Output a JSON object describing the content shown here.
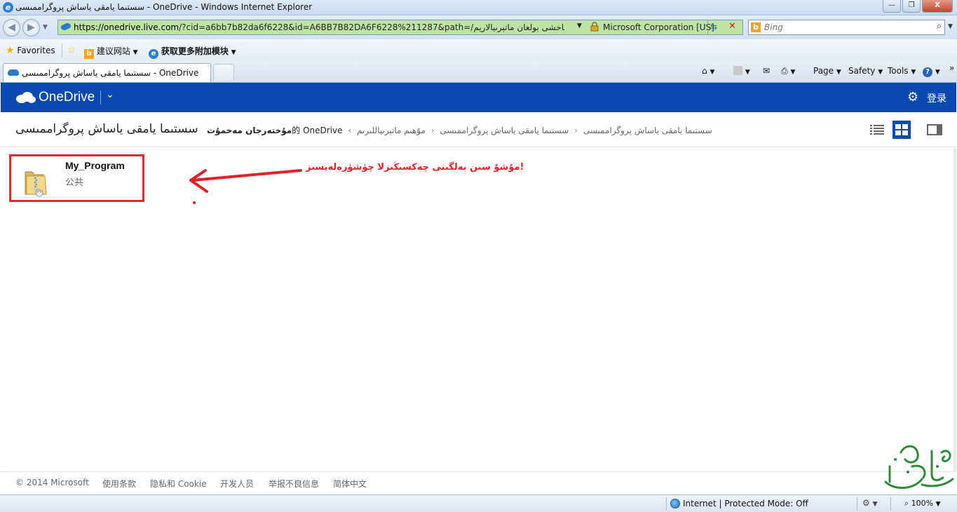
{
  "window": {
    "title": "سستىما يامقى ياساش پروگراممىسى - OneDrive - Windows Internet Explorer",
    "controls": {
      "minimize": "—",
      "maximize": "❐",
      "close": "X"
    }
  },
  "nav": {
    "back_icon": "back-arrow-icon",
    "forward_icon": "forward-arrow-icon",
    "address_host": "https://onedrive.live.com",
    "address_rest": "/?cid=a6bb7b82da6f6228&id=A6BB7B82DA6F6228%211287&path=/سستىما يامقى ياساش پروگراممىسى/ئىنتايىن ساپلىقى ياخشى بولغان ماتېرىيالاريم",
    "certificate": "Microsoft Corporation [US]",
    "search_placeholder": "Bing"
  },
  "favorites_bar": {
    "favorites_label": "Favorites",
    "suggested_sites": "建议网站",
    "get_more_addons": "获取更多附加模块"
  },
  "tabs": [
    {
      "label": "سستىما يامقى ياساش پروگراممىسى - OneDrive"
    }
  ],
  "command_bar": {
    "page": "Page",
    "safety": "Safety",
    "tools": "Tools"
  },
  "onedrive": {
    "brand": "OneDrive",
    "sign_in": "登录",
    "page_title": "سستىما يامقى ياساش پروگراممىسى",
    "breadcrumb": {
      "owner": "مۇختەرجان مەخمۇت",
      "owner_suffix": "的",
      "root": "OneDrive",
      "level1": "سستىما يامقى ياساش پروگراممىسى",
      "level2": "سستىما يامقى ياساش پروگراممىسى",
      "current": "مۇھىم ماتېرىياللىرىم"
    },
    "folders": [
      {
        "name": "My_Program",
        "sharing": "公共"
      }
    ],
    "annotation": "مۇشۇ سىن بەلگىنى چەكسىڭىزلا چۈشۈرەلەيسىز!",
    "footer_links": [
      "© 2014 Microsoft",
      "使用条款",
      "隐私和 Cookie",
      "开发人员",
      "举报不良信息",
      "简体中文"
    ]
  },
  "status_bar": {
    "zone": "Internet | Protected Mode: Off",
    "zoom": "100%"
  },
  "colors": {
    "onedrive_blue": "#094ab2",
    "annotation_red": "#e32028"
  }
}
